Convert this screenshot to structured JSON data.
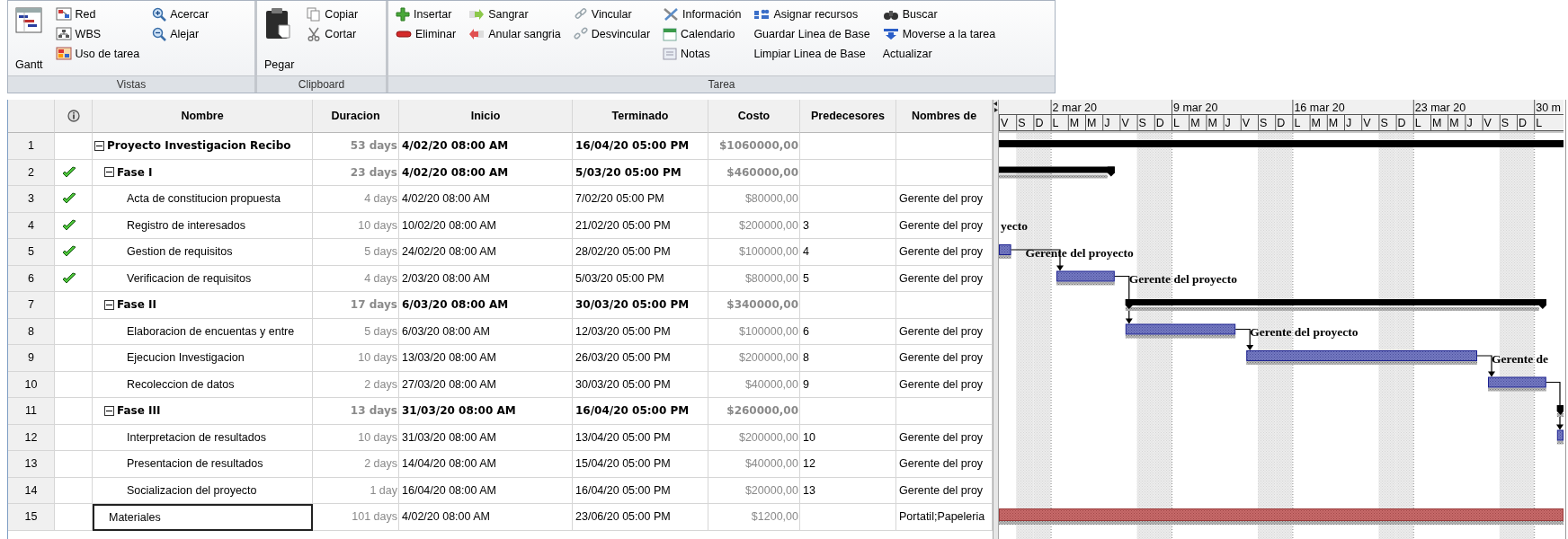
{
  "ribbon": {
    "groups": [
      {
        "label": "Vistas",
        "columns": [
          [
            {
              "label": "Gantt",
              "kind": "large"
            }
          ],
          [
            {
              "label": "Red",
              "kind": "small"
            },
            {
              "label": "WBS",
              "kind": "small"
            },
            {
              "label": "Uso de tarea",
              "kind": "small"
            }
          ],
          [
            {
              "label": "Acercar",
              "kind": "small"
            },
            {
              "label": "Alejar",
              "kind": "small"
            }
          ]
        ]
      },
      {
        "label": "Clipboard",
        "columns": [
          [
            {
              "label": "Pegar",
              "kind": "large"
            }
          ],
          [
            {
              "label": "Copiar",
              "kind": "small"
            },
            {
              "label": "Cortar",
              "kind": "small"
            }
          ]
        ]
      },
      {
        "label": "Tarea",
        "columns": [
          [
            {
              "label": "Insertar",
              "kind": "small"
            },
            {
              "label": "Eliminar",
              "kind": "small"
            }
          ],
          [
            {
              "label": "Sangrar",
              "kind": "small"
            },
            {
              "label": "Anular sangria",
              "kind": "small"
            }
          ],
          [
            {
              "label": "Vincular",
              "kind": "small"
            },
            {
              "label": "Desvincular",
              "kind": "small"
            }
          ],
          [
            {
              "label": "Información",
              "kind": "small"
            },
            {
              "label": "Calendario",
              "kind": "small"
            },
            {
              "label": "Notas",
              "kind": "small"
            }
          ],
          [
            {
              "label": "Asignar recursos",
              "kind": "small"
            },
            {
              "label": "Guardar Linea de Base",
              "kind": "small"
            },
            {
              "label": "Limpiar Linea de Base",
              "kind": "small"
            }
          ],
          [
            {
              "label": "Buscar",
              "kind": "small"
            },
            {
              "label": "Moverse a la tarea",
              "kind": "small"
            },
            {
              "label": "Actualizar",
              "kind": "small"
            }
          ]
        ]
      }
    ]
  },
  "table": {
    "columns": [
      "Nombre",
      "Duracion",
      "Inicio",
      "Terminado",
      "Costo",
      "Predecesores",
      "Nombres de"
    ]
  },
  "tasks": [
    {
      "number": "1",
      "name": "Proyecto Investigacion Recibo",
      "duration": "53 days",
      "start": "4/02/20 08:00 AM",
      "finish": "16/04/20 05:00 PM",
      "cost": "$1060000,00",
      "kind": "project",
      "done": false,
      "selected": false,
      "expanded": true,
      "children": [
        {
          "number": "2",
          "name": "Fase I",
          "duration": "23 days",
          "start": "4/02/20 08:00 AM",
          "finish": "5/03/20 05:00 PM",
          "cost": "$460000,00",
          "kind": "summary",
          "done": true,
          "selected": false,
          "expanded": true,
          "children": [
            {
              "number": "3",
              "name": "Acta de constitucion propuesta",
              "duration": "4 days",
              "start": "4/02/20 08:00 AM",
              "finish": "7/02/20 05:00 PM",
              "cost": "$80000,00",
              "resources": "Gerente del proy",
              "kind": "task",
              "done": true,
              "selected": false
            },
            {
              "number": "4",
              "name": "Registro de interesados",
              "duration": "10 days",
              "start": "10/02/20 08:00 AM",
              "finish": "21/02/20 05:00 PM",
              "cost": "$200000,00",
              "predecessors": "3",
              "resources": "Gerente del proy",
              "kind": "task",
              "done": true,
              "selected": false,
              "bar_label": "yecto"
            },
            {
              "number": "5",
              "name": "Gestion de requisitos",
              "duration": "5 days",
              "start": "24/02/20 08:00 AM",
              "finish": "28/02/20 05:00 PM",
              "cost": "$100000,00",
              "predecessors": "4",
              "resources": "Gerente del proy",
              "kind": "task",
              "done": true,
              "selected": false,
              "bar_label": "Gerente del proyecto",
              "arrow_out": true
            },
            {
              "number": "6",
              "name": "Verificacion de requisitos",
              "duration": "4 days",
              "start": "2/03/20 08:00 AM",
              "finish": "5/03/20 05:00 PM",
              "cost": "$80000,00",
              "predecessors": "5",
              "resources": "Gerente del proy",
              "kind": "task",
              "done": true,
              "selected": false,
              "bar_label": "Gerente del proyecto",
              "arrow_out": true
            }
          ]
        },
        {
          "number": "7",
          "name": "Fase II",
          "duration": "17 days",
          "start": "6/03/20 08:00 AM",
          "finish": "30/03/20 05:00 PM",
          "cost": "$340000,00",
          "kind": "summary",
          "done": false,
          "selected": false,
          "expanded": true,
          "children": [
            {
              "number": "8",
              "name": "Elaboracion de encuentas y entre",
              "duration": "5 days",
              "start": "6/03/20 08:00 AM",
              "finish": "12/03/20 05:00 PM",
              "cost": "$100000,00",
              "predecessors": "6",
              "resources": "Gerente del proy",
              "kind": "task",
              "done": false,
              "selected": false,
              "bar_label": "Gerente del proyecto",
              "arrow_out": true
            },
            {
              "number": "9",
              "name": "Ejecucion Investigacion",
              "duration": "10 days",
              "start": "13/03/20 08:00 AM",
              "finish": "26/03/20 05:00 PM",
              "cost": "$200000,00",
              "predecessors": "8",
              "resources": "Gerente del proy",
              "kind": "task",
              "done": false,
              "selected": false,
              "bar_label": "Gerente de",
              "arrow_out": true
            },
            {
              "number": "10",
              "name": "Recoleccion de datos",
              "duration": "2 days",
              "start": "27/03/20 08:00 AM",
              "finish": "30/03/20 05:00 PM",
              "cost": "$40000,00",
              "predecessors": "9",
              "resources": "Gerente del proy",
              "kind": "task",
              "done": false,
              "selected": false,
              "arrow_out": true
            }
          ]
        },
        {
          "number": "11",
          "name": "Fase III",
          "duration": "13 days",
          "start": "31/03/20 08:00 AM",
          "finish": "16/04/20 05:00 PM",
          "cost": "$260000,00",
          "kind": "summary",
          "done": false,
          "selected": false,
          "expanded": true,
          "children": [
            {
              "number": "12",
              "name": "Interpretacion de resultados",
              "duration": "10 days",
              "start": "31/03/20 08:00 AM",
              "finish": "13/04/20 05:00 PM",
              "cost": "$200000,00",
              "predecessors": "10",
              "resources": "Gerente del proy",
              "kind": "task",
              "done": false,
              "selected": false
            },
            {
              "number": "13",
              "name": "Presentacion de resultados",
              "duration": "2 days",
              "start": "14/04/20 08:00 AM",
              "finish": "15/04/20 05:00 PM",
              "cost": "$40000,00",
              "predecessors": "12",
              "resources": "Gerente del proy",
              "kind": "task",
              "done": false,
              "selected": false
            },
            {
              "number": "14",
              "name": "Socializacion del proyecto",
              "duration": "1 day",
              "start": "16/04/20 08:00 AM",
              "finish": "16/04/20 05:00 PM",
              "cost": "$20000,00",
              "predecessors": "13",
              "resources": "Gerente del proy",
              "kind": "task",
              "done": false,
              "selected": false
            }
          ]
        }
      ]
    },
    {
      "number": "15",
      "name": "Materiales",
      "duration": "101 days",
      "start": "4/02/20 08:00 AM",
      "finish": "23/06/20 05:00 PM",
      "cost": "$1200,00",
      "resources": "Portatil;Papeleria",
      "kind": "material",
      "done": false,
      "selected": true
    }
  ],
  "timeline": {
    "weeks": [
      {
        "days": [
          {
            "letter": "V",
            "weekend": false
          },
          {
            "letter": "S",
            "weekend": true
          },
          {
            "letter": "D",
            "weekend": true
          }
        ]
      },
      {
        "label": "2 mar 20",
        "days": [
          {
            "letter": "L",
            "weekend": false
          },
          {
            "letter": "M",
            "weekend": false
          },
          {
            "letter": "M",
            "weekend": false
          },
          {
            "letter": "J",
            "weekend": false
          },
          {
            "letter": "V",
            "weekend": false
          },
          {
            "letter": "S",
            "weekend": true
          },
          {
            "letter": "D",
            "weekend": true
          }
        ]
      },
      {
        "label": "9 mar 20",
        "days": [
          {
            "letter": "L",
            "weekend": false
          },
          {
            "letter": "M",
            "weekend": false
          },
          {
            "letter": "M",
            "weekend": false
          },
          {
            "letter": "J",
            "weekend": false
          },
          {
            "letter": "V",
            "weekend": false
          },
          {
            "letter": "S",
            "weekend": true
          },
          {
            "letter": "D",
            "weekend": true
          }
        ]
      },
      {
        "label": "16 mar 20",
        "days": [
          {
            "letter": "L",
            "weekend": false
          },
          {
            "letter": "M",
            "weekend": false
          },
          {
            "letter": "M",
            "weekend": false
          },
          {
            "letter": "J",
            "weekend": false
          },
          {
            "letter": "V",
            "weekend": false
          },
          {
            "letter": "S",
            "weekend": true
          },
          {
            "letter": "D",
            "weekend": true
          }
        ]
      },
      {
        "label": "23 mar 20",
        "days": [
          {
            "letter": "L",
            "weekend": false
          },
          {
            "letter": "M",
            "weekend": false
          },
          {
            "letter": "M",
            "weekend": false
          },
          {
            "letter": "J",
            "weekend": false
          },
          {
            "letter": "V",
            "weekend": false
          },
          {
            "letter": "S",
            "weekend": true
          },
          {
            "letter": "D",
            "weekend": true
          }
        ]
      },
      {
        "label": "30 m",
        "days": [
          {
            "letter": "L",
            "weekend": false
          }
        ]
      }
    ]
  }
}
